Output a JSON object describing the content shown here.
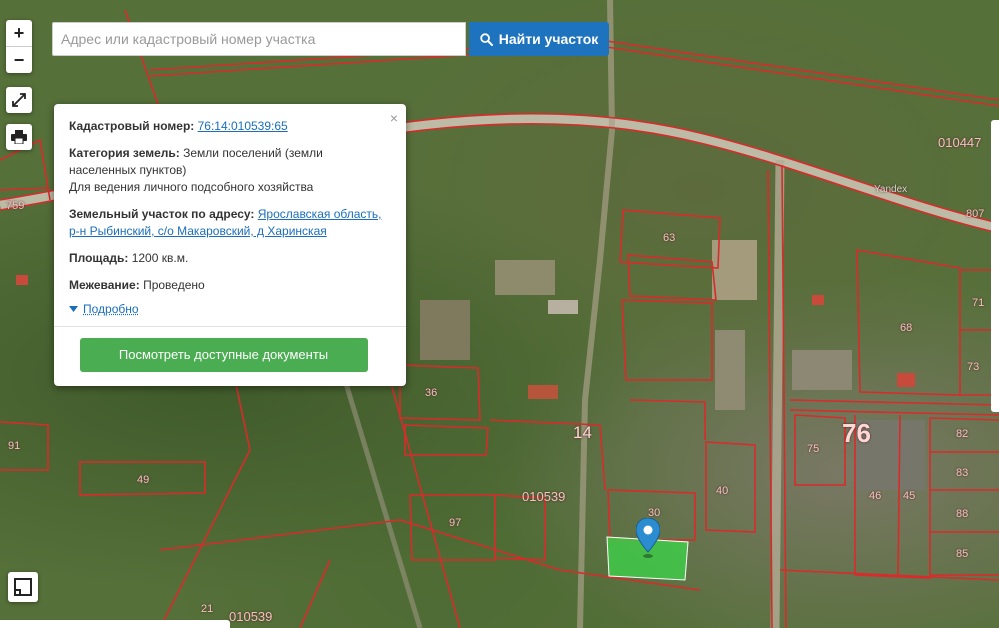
{
  "search": {
    "placeholder": "Адрес или кадастровый номер участка",
    "button_label": "Найти участок"
  },
  "controls": {
    "zoom_in": "+",
    "zoom_out": "−",
    "fullscreen_icon": "expand-icon",
    "print_icon": "printer-icon",
    "layers_icon": "layers-icon"
  },
  "popup": {
    "close": "×",
    "cadastral_label": "Кадастровый номер:",
    "cadastral_value": "76:14:010539:65",
    "category_label": "Категория земель:",
    "category_value": "Земли поселений (земли населенных пунктов)",
    "usage_value": "Для ведения личного подсобного хозяйства",
    "address_label": "Земельный участок по адресу:",
    "address_value": "Ярославская область, р-н Рыбинский, с/о Макаровский, д Харинская",
    "area_label": "Площадь:",
    "area_value": "1200 кв.м.",
    "survey_label": "Межевание:",
    "survey_value": "Проведено",
    "more_link": "Подробно",
    "docs_button": "Посмотреть доступные документы"
  },
  "map_labels": {
    "l_010447": "010447",
    "l_759": "759",
    "l_807": "807",
    "l_63": "63",
    "l_71": "71",
    "l_68": "68",
    "l_73": "73",
    "l_36": "36",
    "l_14": "14",
    "l_76": "76",
    "l_91": "91",
    "l_49": "49",
    "l_75": "75",
    "l_82": "82",
    "l_83": "83",
    "l_40": "40",
    "l_010539a": "010539",
    "l_97": "97",
    "l_30": "30",
    "l_46": "46",
    "l_45": "45",
    "l_88": "88",
    "l_85": "85",
    "l_21": "21",
    "l_010539b": "010539",
    "l_yandex": "Yandex"
  },
  "colors": {
    "boundary": "#d92b2b",
    "search_button": "#1e73be",
    "docs_button": "#4aad52",
    "selected_plot": "#3fd14a",
    "link": "#1a6ebc"
  }
}
